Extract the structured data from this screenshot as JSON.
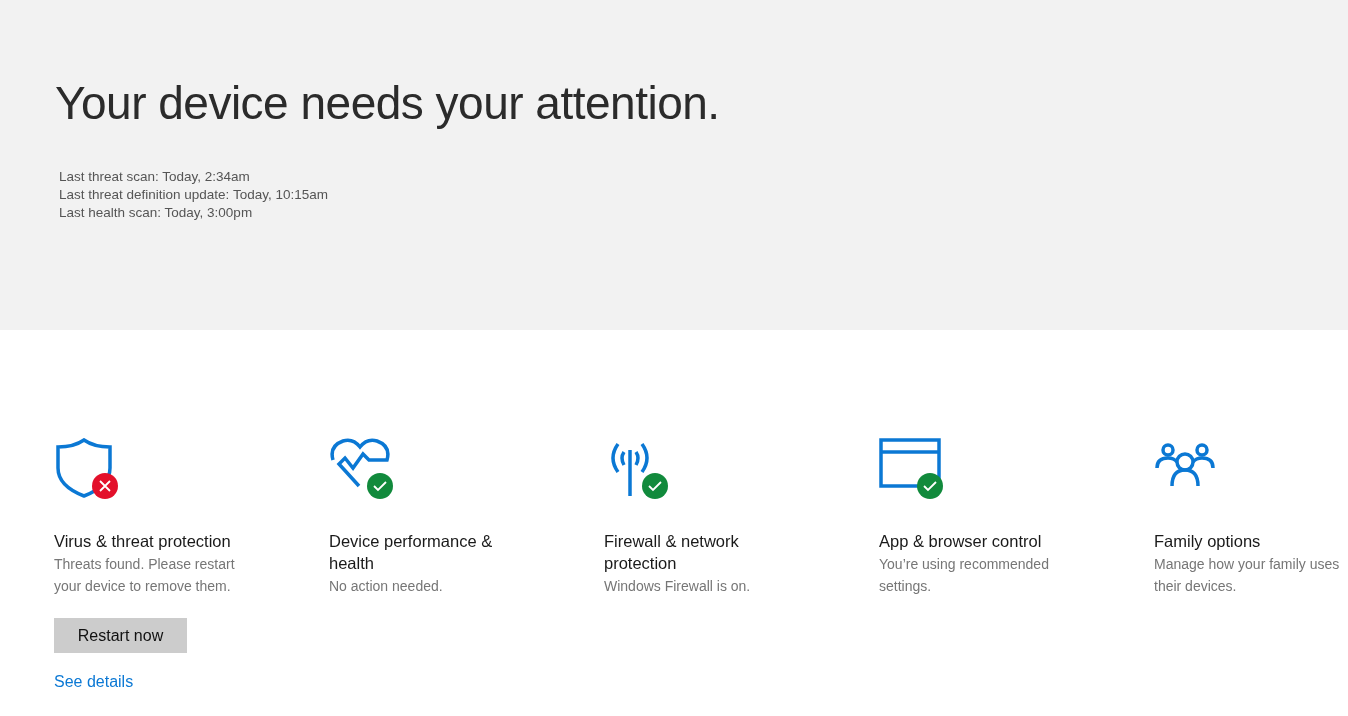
{
  "header": {
    "title": "Your device needs your attention.",
    "scan_info": [
      "Last threat scan: Today, 2:34am",
      "Last threat definition update: Today, 10:15am",
      "Last health scan: Today, 3:00pm"
    ]
  },
  "tiles": [
    {
      "kind": "shield",
      "error": true,
      "ok": false,
      "title": "Virus & threat protection",
      "description": "Threats found. Please restart your device to remove them.",
      "button": "Restart now",
      "link": "See details"
    },
    {
      "kind": "heart",
      "error": false,
      "ok": true,
      "title": "Device performance & health",
      "description": "No action needed."
    },
    {
      "kind": "antenna",
      "error": false,
      "ok": true,
      "title": "Firewall & network protection",
      "description": "Windows Firewall is on."
    },
    {
      "kind": "window",
      "error": false,
      "ok": true,
      "title": "App & browser control",
      "description": "You’re using recommended settings."
    },
    {
      "kind": "family",
      "error": false,
      "ok": false,
      "title": "Family options",
      "description": "Manage how your family uses their devices."
    }
  ]
}
